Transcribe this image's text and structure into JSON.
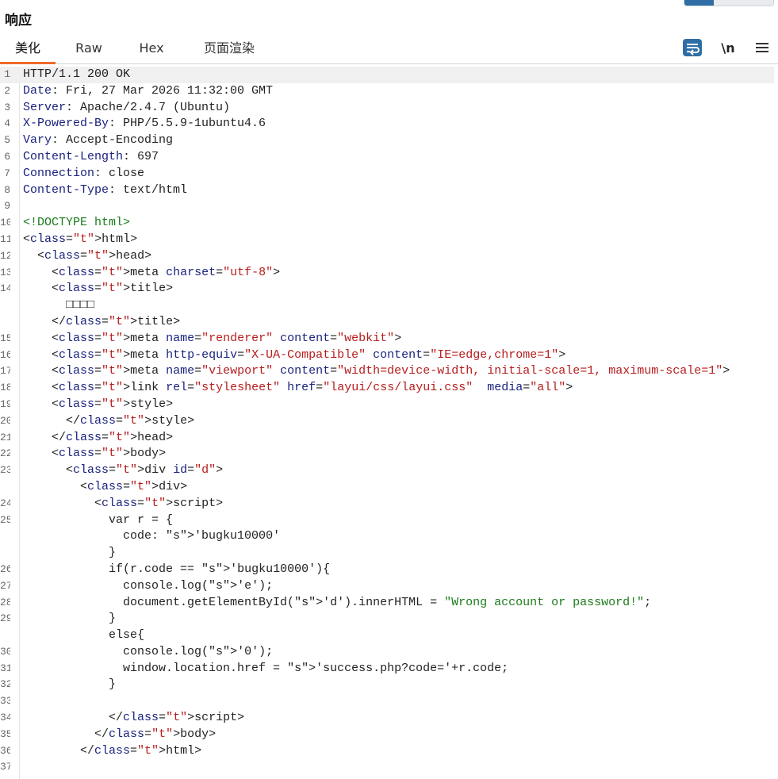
{
  "pane": {
    "title": "响应"
  },
  "tabs": [
    {
      "label": "美化",
      "active": true
    },
    {
      "label": "Raw",
      "active": false
    },
    {
      "label": "Hex",
      "active": false
    },
    {
      "label": "页面渲染",
      "active": false
    }
  ],
  "toolbar": {
    "wrap_icon": "wrap-lines-icon",
    "newline_label": "\\n",
    "menu_icon": "hamburger-menu-icon"
  },
  "colors": {
    "accent_tab": "#f06a2a",
    "wrap_icon": "#2f6ea5",
    "header_key": "#1a237e",
    "tag": "#b71c1c",
    "string": "#1b7c1b"
  },
  "code": {
    "lines": [
      {
        "num": "1",
        "text": "HTTP/1.1 200 OK"
      },
      {
        "num": "2",
        "key": "Date",
        "text": ": Fri, 27 Mar 2026 11:32:00 GMT"
      },
      {
        "num": "3",
        "key": "Server",
        "text": ": Apache/2.4.7 (Ubuntu)"
      },
      {
        "num": "4",
        "key": "X-Powered-By",
        "text": ": PHP/5.5.9-1ubuntu4.6"
      },
      {
        "num": "5",
        "key": "Vary",
        "text": ": Accept-Encoding"
      },
      {
        "num": "6",
        "key": "Content-Length",
        "text": ": 697"
      },
      {
        "num": "7",
        "key": "Connection",
        "text": ": close"
      },
      {
        "num": "8",
        "key": "Content-Type",
        "text": ": text/html"
      },
      {
        "num": "9",
        "text": ""
      },
      {
        "num": "10",
        "text": "<!DOCTYPE html>"
      },
      {
        "num": "11",
        "text": "<html>"
      },
      {
        "num": "12",
        "text": "  <head>"
      },
      {
        "num": "13",
        "text": "    <meta charset=\"utf-8\">"
      },
      {
        "num": "14",
        "text": "    <title>"
      },
      {
        "num": "",
        "text": "      □□□□"
      },
      {
        "num": "",
        "text": "    </title>"
      },
      {
        "num": "15",
        "text": "    <meta name=\"renderer\" content=\"webkit\">"
      },
      {
        "num": "16",
        "text": "    <meta http-equiv=\"X-UA-Compatible\" content=\"IE=edge,chrome=1\">"
      },
      {
        "num": "17",
        "text": "    <meta name=\"viewport\" content=\"width=device-width, initial-scale=1, maximum-scale=1\">"
      },
      {
        "num": "18",
        "text": "    <link rel=\"stylesheet\" href=\"layui/css/layui.css\"  media=\"all\">"
      },
      {
        "num": "19",
        "text": "    <style>"
      },
      {
        "num": "20",
        "text": "      </style>"
      },
      {
        "num": "21",
        "text": "    </head>"
      },
      {
        "num": "22",
        "text": "    <body>"
      },
      {
        "num": "23",
        "text": "      <div id=\"d\">"
      },
      {
        "num": "",
        "text": "        <div>"
      },
      {
        "num": "24",
        "text": "          <script>"
      },
      {
        "num": "25",
        "text": "            var r = {"
      },
      {
        "num": "",
        "text": "              code: 'bugku10000'"
      },
      {
        "num": "",
        "text": "            }"
      },
      {
        "num": "26",
        "text": "            if(r.code == 'bugku10000'){"
      },
      {
        "num": "27",
        "text": "              console.log('e');"
      },
      {
        "num": "28",
        "text": "              document.getElementById('d').innerHTML = \"Wrong account or password!\";"
      },
      {
        "num": "29",
        "text": "            }"
      },
      {
        "num": "",
        "text": "            else{"
      },
      {
        "num": "30",
        "text": "              console.log('0');"
      },
      {
        "num": "31",
        "text": "              window.location.href = 'success.php?code='+r.code;"
      },
      {
        "num": "32",
        "text": "            }"
      },
      {
        "num": "33",
        "text": ""
      },
      {
        "num": "34",
        "text": "            </script>"
      },
      {
        "num": "35",
        "text": "          </body>"
      },
      {
        "num": "36",
        "text": "        </html>"
      },
      {
        "num": "37",
        "text": ""
      }
    ]
  }
}
